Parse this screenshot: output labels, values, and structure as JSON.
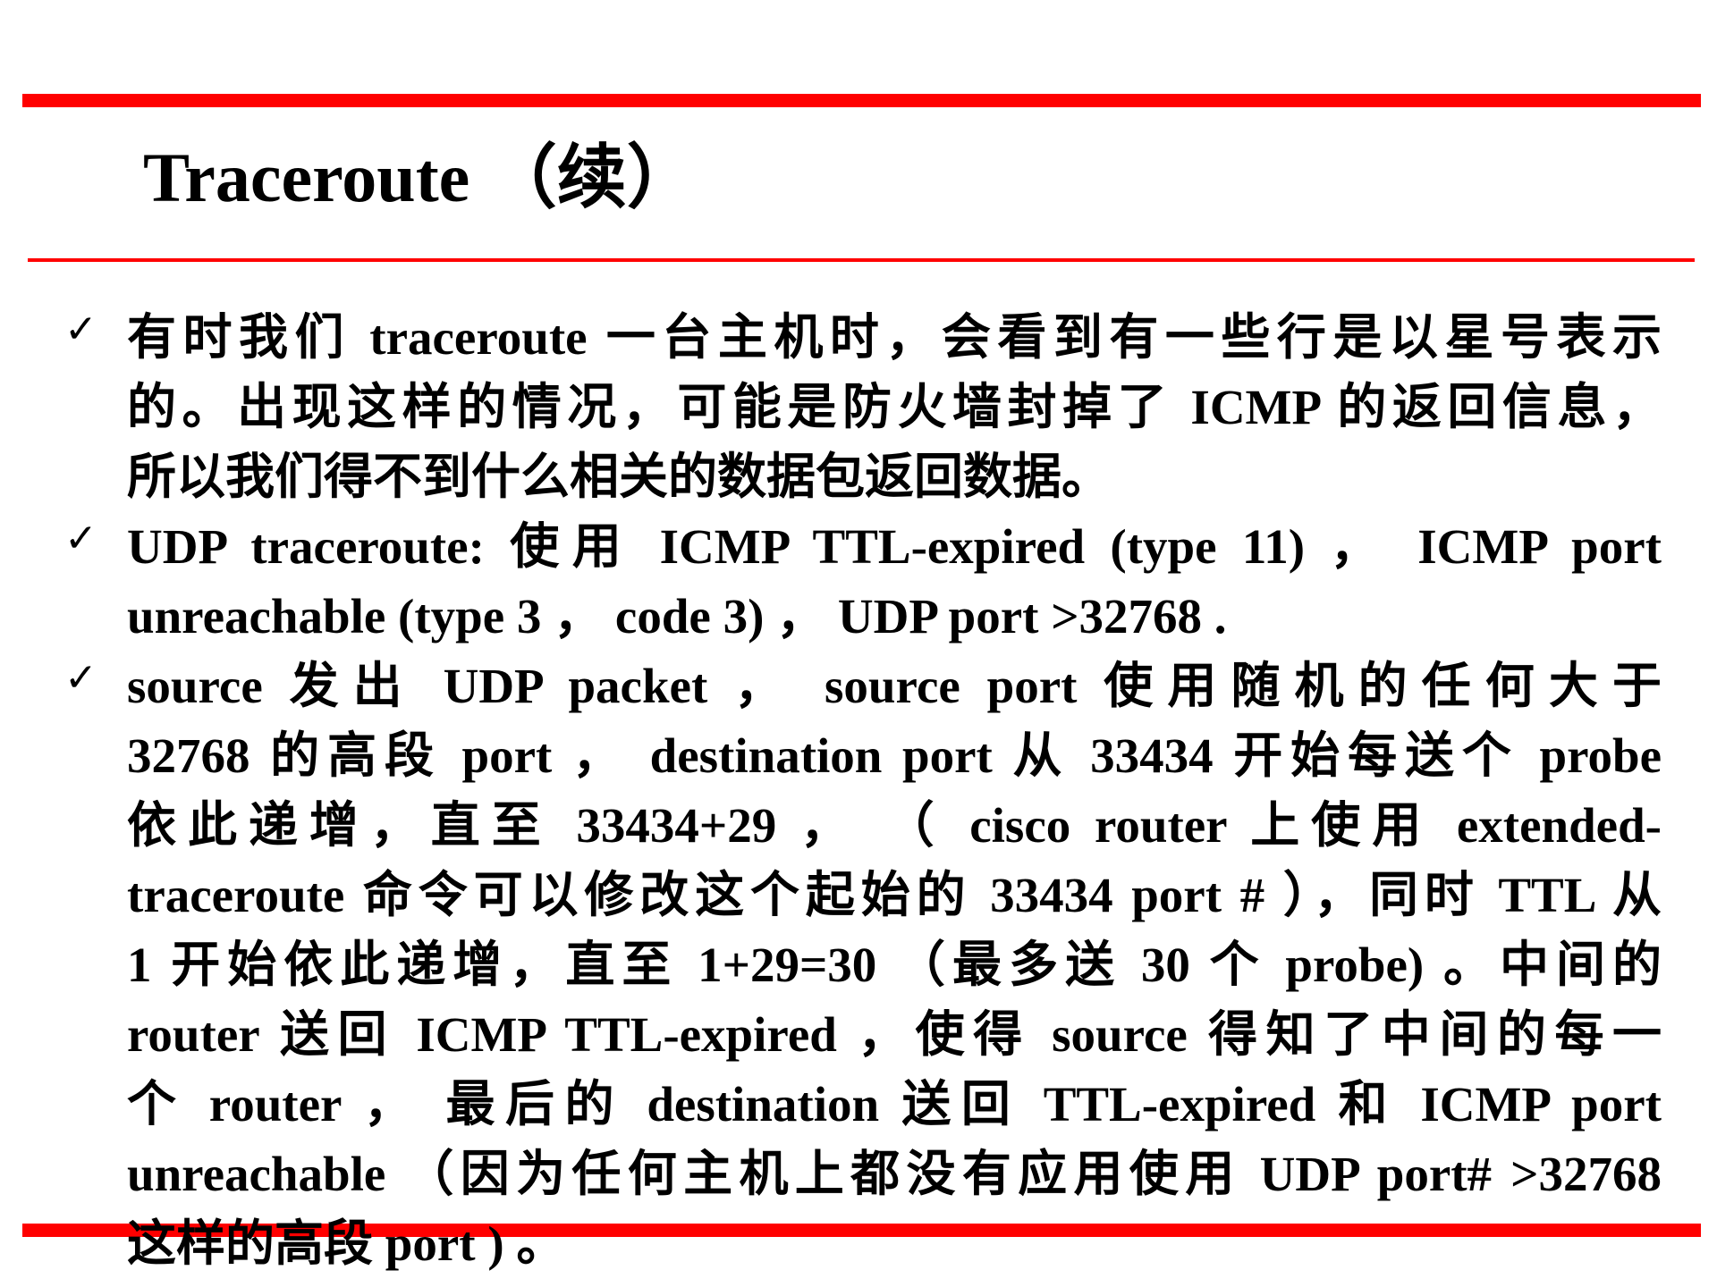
{
  "slide": {
    "title": "Traceroute （续）",
    "bullets": [
      {
        "icon": "checkmark-icon",
        "lines": [
          "有时我们 traceroute  一台主机时，会看到有一些行是以星号表示",
          "的。出现这样的情况，可能是防火墙封掉了 ICMP 的返回信息，",
          "所以我们得不到什么相关的数据包返回数据。"
        ]
      },
      {
        "icon": "checkmark-icon",
        "lines": [
          "UDP traceroute:  使用 ICMP TTL-expired (type 11) ， ICMP port",
          "unreachable (type 3 ，   code 3) ，   UDP port >32768 ."
        ]
      },
      {
        "icon": "checkmark-icon",
        "lines": [
          "source 发出 UDP packet ，   source port 使用随机的任何大于",
          "32768 的高段 port ，   destination  port 从 33434 开始每送个 probe",
          "依此递增，直至 33434+29 ， （ cisco  router 上使用 extended-",
          "traceroute 命令可以修改这个起始的 33434 port # ），同时 TTL 从",
          "1 开始依此递增，直至 1+29=30 （最多送 30 个 probe) 。中间的",
          "router 送回  ICMP  TTL-expired ，使得 source 得知了中间的每一",
          "个 router ，  最后的 destination 送回 TTL-expired  和 ICMP  port",
          "unreachable  （因为任何主机上都没有应用使用 UDP port# >32768",
          "这样的高段 port ) 。"
        ]
      }
    ]
  },
  "colors": {
    "accent": "#ff0000",
    "text": "#000000"
  }
}
